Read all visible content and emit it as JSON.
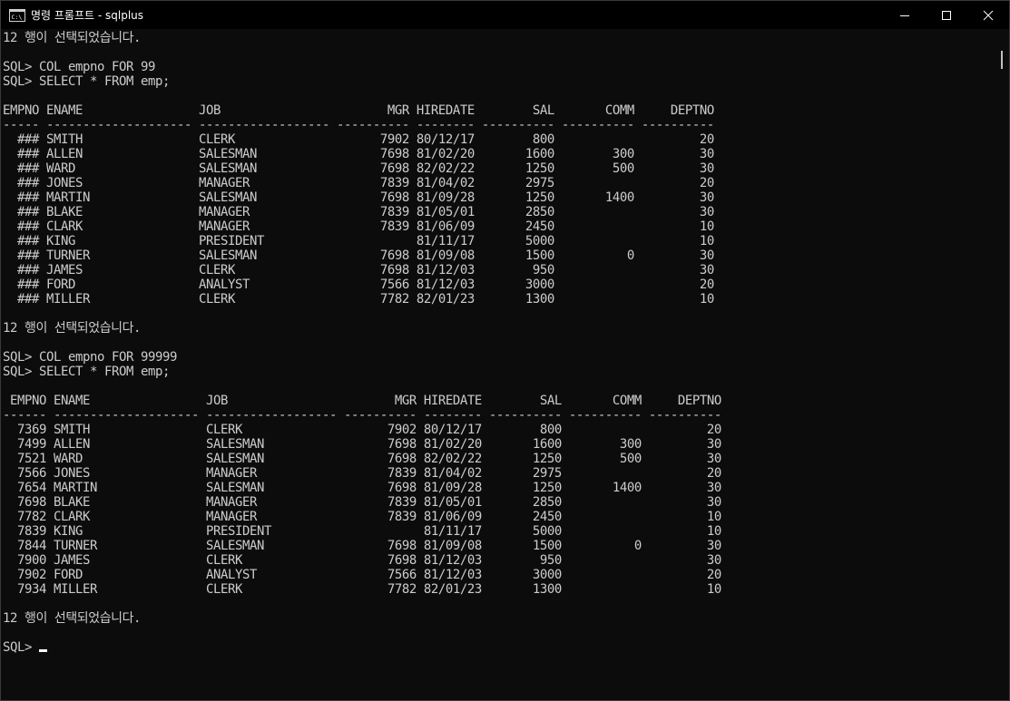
{
  "window": {
    "title": "명령 프롬프트 - sqlplus"
  },
  "icons": {
    "app": "cmd-icon",
    "minimize": "minimize-icon",
    "maximize": "maximize-icon",
    "close": "close-icon"
  },
  "console": {
    "lines": [
      "12 행이 선택되었습니다.",
      "",
      "SQL> COL empno FOR 99",
      "SQL> SELECT * FROM emp;",
      "",
      "EMPNO ENAME                JOB                       MGR HIREDATE        SAL       COMM     DEPTNO",
      "----- -------------------- ------------------ ---------- -------- ---------- ---------- ----------",
      "  ### SMITH                CLERK                    7902 80/12/17        800                    20",
      "  ### ALLEN                SALESMAN                 7698 81/02/20       1600        300         30",
      "  ### WARD                 SALESMAN                 7698 82/02/22       1250        500         30",
      "  ### JONES                MANAGER                  7839 81/04/02       2975                    20",
      "  ### MARTIN               SALESMAN                 7698 81/09/28       1250       1400         30",
      "  ### BLAKE                MANAGER                  7839 81/05/01       2850                    30",
      "  ### CLARK                MANAGER                  7839 81/06/09       2450                    10",
      "  ### KING                 PRESIDENT                     81/11/17       5000                    10",
      "  ### TURNER               SALESMAN                 7698 81/09/08       1500          0         30",
      "  ### JAMES                CLERK                    7698 81/12/03        950                    30",
      "  ### FORD                 ANALYST                  7566 81/12/03       3000                    20",
      "  ### MILLER               CLERK                    7782 82/01/23       1300                    10",
      "",
      "12 행이 선택되었습니다.",
      "",
      "SQL> COL empno FOR 99999",
      "SQL> SELECT * FROM emp;",
      "",
      " EMPNO ENAME                JOB                       MGR HIREDATE        SAL       COMM     DEPTNO",
      "------ -------------------- ------------------ ---------- -------- ---------- ---------- ----------",
      "  7369 SMITH                CLERK                    7902 80/12/17        800                    20",
      "  7499 ALLEN                SALESMAN                 7698 81/02/20       1600        300         30",
      "  7521 WARD                 SALESMAN                 7698 82/02/22       1250        500         30",
      "  7566 JONES                MANAGER                  7839 81/04/02       2975                    20",
      "  7654 MARTIN               SALESMAN                 7698 81/09/28       1250       1400         30",
      "  7698 BLAKE                MANAGER                  7839 81/05/01       2850                    30",
      "  7782 CLARK                MANAGER                  7839 81/06/09       2450                    10",
      "  7839 KING                 PRESIDENT                     81/11/17       5000                    10",
      "  7844 TURNER               SALESMAN                 7698 81/09/08       1500          0         30",
      "  7900 JAMES                CLERK                    7698 81/12/03        950                    30",
      "  7902 FORD                 ANALYST                  7566 81/12/03       3000                    20",
      "  7934 MILLER               CLERK                    7782 82/01/23       1300                    10",
      "",
      "12 행이 선택되었습니다.",
      "",
      "SQL> "
    ]
  }
}
